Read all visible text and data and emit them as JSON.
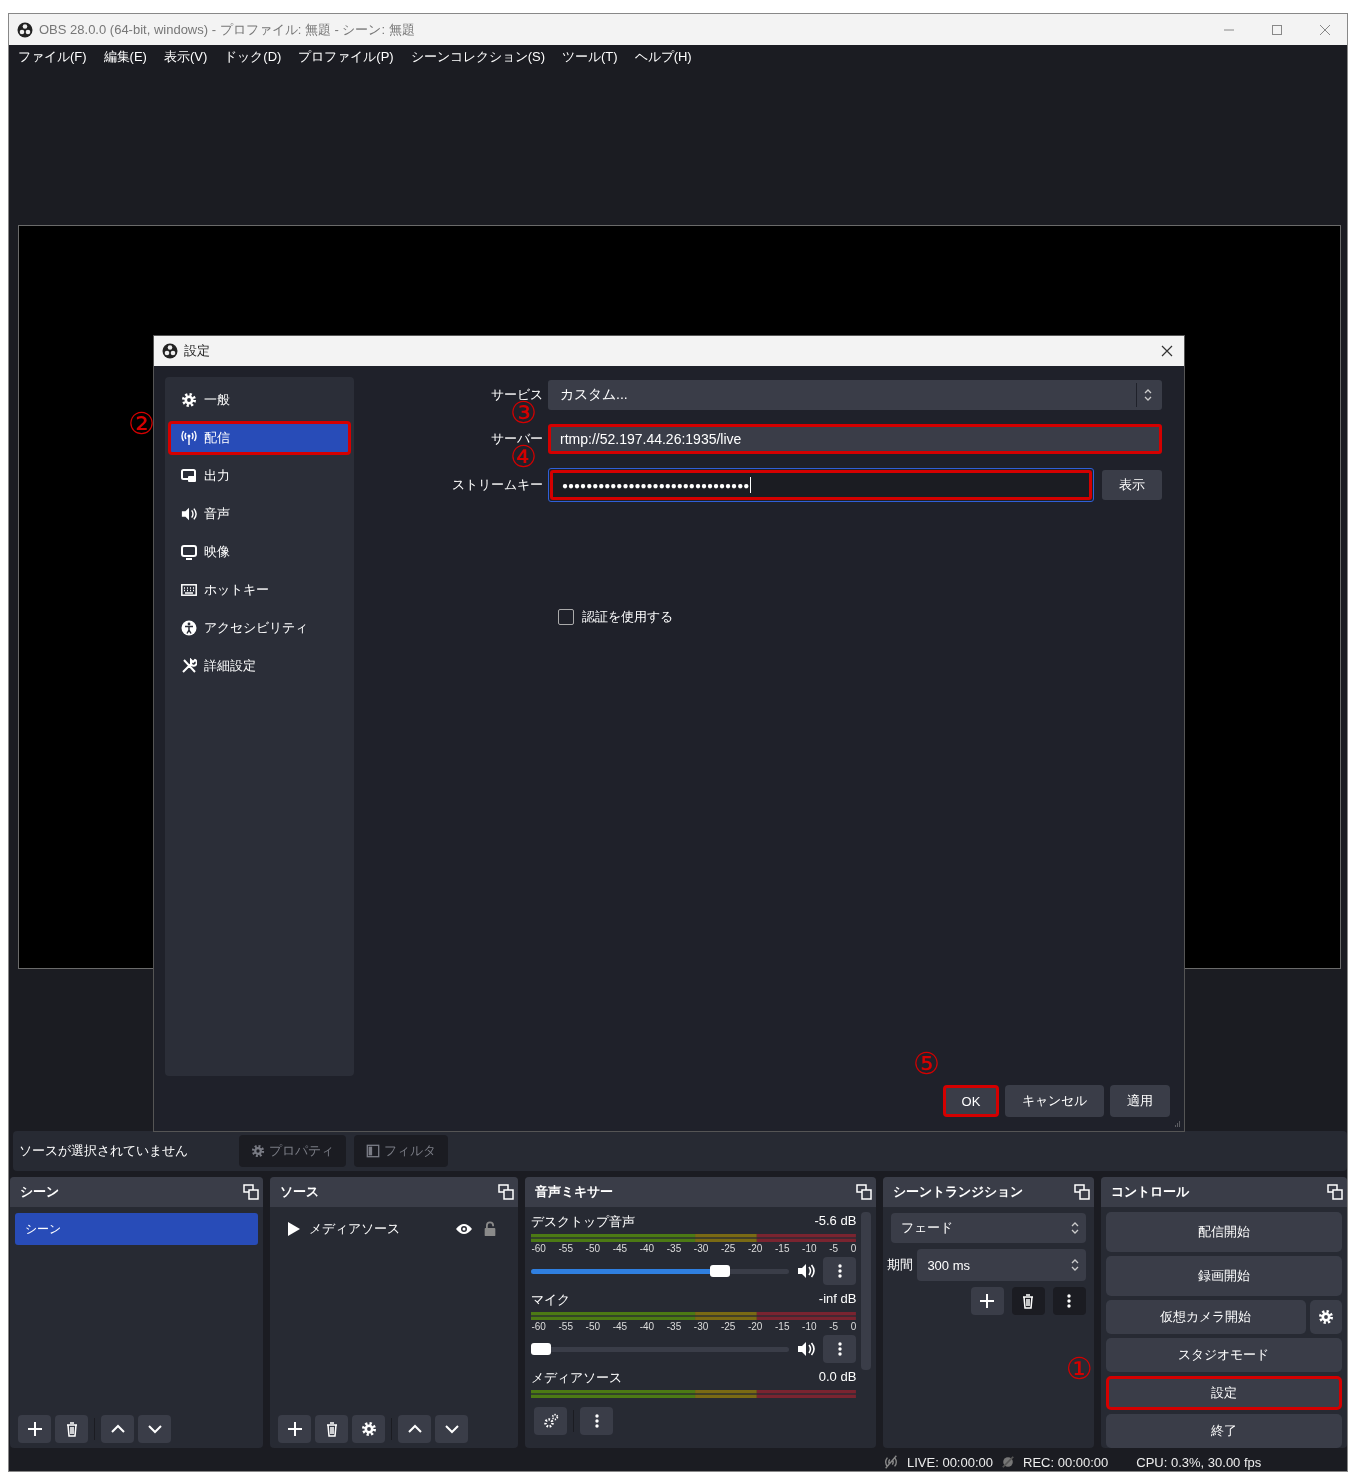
{
  "window": {
    "title": "OBS 28.0.0 (64-bit, windows) - プロファイル: 無題 - シーン: 無題"
  },
  "menu": [
    "ファイル(F)",
    "編集(E)",
    "表示(V)",
    "ドック(D)",
    "プロファイル(P)",
    "シーンコレクション(S)",
    "ツール(T)",
    "ヘルプ(H)"
  ],
  "settings_dialog": {
    "title": "設定",
    "nav": [
      {
        "label": "一般",
        "selected": false,
        "highlighted": false
      },
      {
        "label": "配信",
        "selected": true,
        "highlighted": true,
        "callout": "②"
      },
      {
        "label": "出力",
        "selected": false,
        "highlighted": false
      },
      {
        "label": "音声",
        "selected": false,
        "highlighted": false
      },
      {
        "label": "映像",
        "selected": false,
        "highlighted": false
      },
      {
        "label": "ホットキー",
        "selected": false,
        "highlighted": false
      },
      {
        "label": "アクセシビリティ",
        "selected": false,
        "highlighted": false
      },
      {
        "label": "詳細設定",
        "selected": false,
        "highlighted": false
      }
    ],
    "fields": [
      {
        "label": "サービス",
        "kind": "select",
        "value": "カスタム...",
        "highlighted": false
      },
      {
        "label": "サーバー",
        "kind": "text",
        "value": "rtmp://52.197.44.26:1935/live",
        "highlighted": true,
        "callout": "③"
      },
      {
        "label": "ストリームキー",
        "kind": "password",
        "value": "●●●●●●●●●●●●●●●●●●●●●●●●●●●●●●●",
        "highlighted": true,
        "focused": true,
        "callout": "④",
        "button": "表示"
      }
    ],
    "checkbox": {
      "label": "認証を使用する",
      "checked": false
    },
    "buttons": [
      {
        "label": "OK",
        "highlighted": true,
        "callout": "⑤"
      },
      {
        "label": "キャンセル",
        "highlighted": false
      },
      {
        "label": "適用",
        "highlighted": false
      }
    ]
  },
  "source_bar": {
    "status": "ソースが選択されていません",
    "buttons": [
      {
        "label": "プロパティ",
        "disabled": true
      },
      {
        "label": "フィルタ",
        "disabled": true
      }
    ]
  },
  "scenes": {
    "title": "シーン",
    "items": [
      {
        "label": "シーン",
        "selected": true
      }
    ]
  },
  "sources": {
    "title": "ソース",
    "items": [
      {
        "label": "メディアソース",
        "visible": true,
        "locked": false
      }
    ]
  },
  "mixer": {
    "title": "音声ミキサー",
    "channels": [
      {
        "name": "デスクトップ音声",
        "reading": "-5.6 dB",
        "level": 0.75,
        "scale": [
          "-60",
          "-55",
          "-50",
          "-45",
          "-40",
          "-35",
          "-30",
          "-25",
          "-20",
          "-15",
          "-10",
          "-5",
          "0"
        ]
      },
      {
        "name": "マイク",
        "reading": "-inf dB",
        "level": 0,
        "scale": [
          "-60",
          "-55",
          "-50",
          "-45",
          "-40",
          "-35",
          "-30",
          "-25",
          "-20",
          "-15",
          "-10",
          "-5",
          "0"
        ]
      },
      {
        "name": "メディアソース",
        "reading": "0.0 dB"
      }
    ]
  },
  "transitions": {
    "title": "シーントランジション",
    "transition": "フェード",
    "duration_label": "期間",
    "duration": "300 ms"
  },
  "controls": {
    "title": "コントロール",
    "buttons": [
      {
        "label": "配信開始",
        "highlighted": false
      },
      {
        "label": "録画開始",
        "highlighted": false
      },
      {
        "label": "仮想カメラ開始",
        "highlighted": false,
        "gear": true
      },
      {
        "label": "スタジオモード",
        "highlighted": false
      },
      {
        "label": "設定",
        "highlighted": true,
        "callout": "①"
      },
      {
        "label": "終了",
        "highlighted": false
      }
    ]
  },
  "status_bar": {
    "live": "LIVE: 00:00:00",
    "rec": "REC: 00:00:00",
    "cpu": "CPU: 0.3%, 30.00 fps"
  }
}
